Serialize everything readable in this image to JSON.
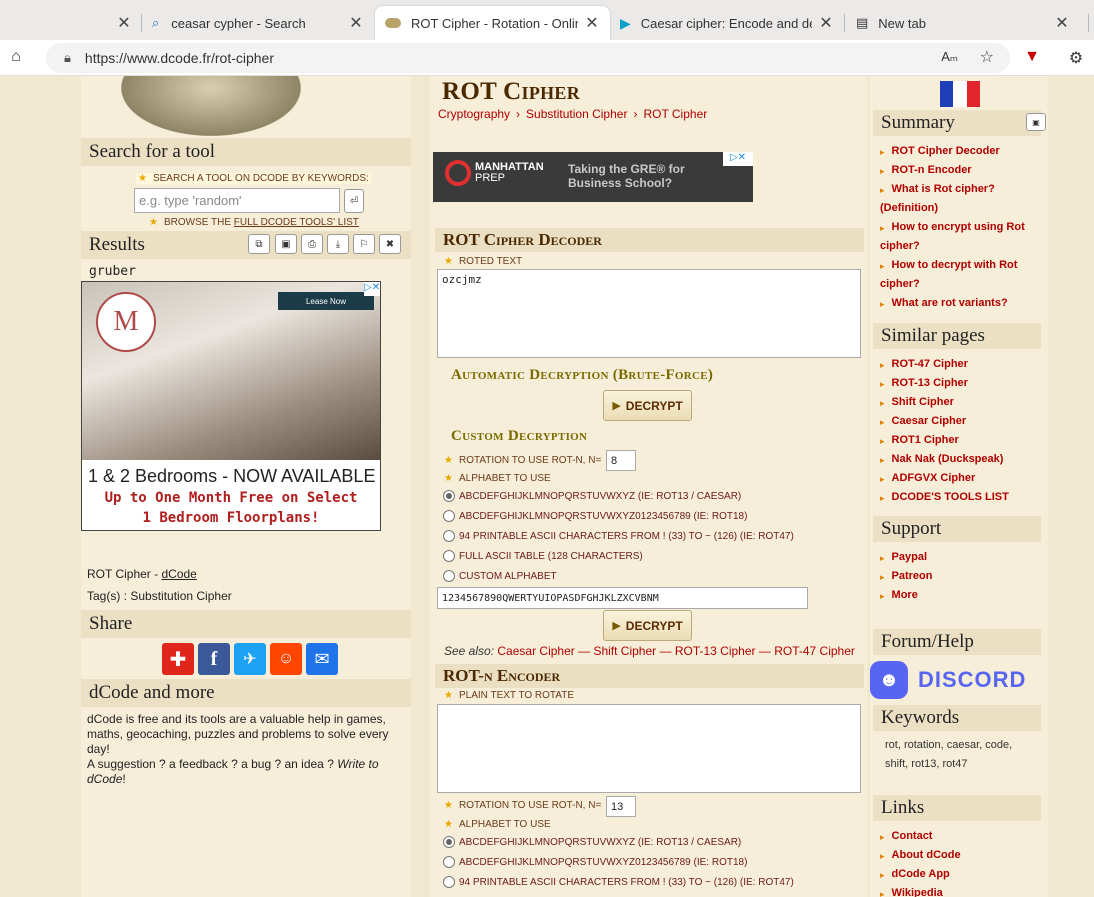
{
  "browser": {
    "tabs": [
      {
        "label": "",
        "icon": "blank"
      },
      {
        "label": "ceasar cypher - Search",
        "icon": "search-icon"
      },
      {
        "label": "ROT Cipher - Rotation - Online R",
        "icon": "dcode-icon",
        "active": true
      },
      {
        "label": "Caesar cipher: Encode and deco",
        "icon": "arrow-icon"
      },
      {
        "label": "New tab",
        "icon": "newtab-icon"
      }
    ],
    "url": "https://www.dcode.fr/rot-cipher"
  },
  "left": {
    "search_title": "Search for a tool",
    "search_keyword_label": "SEARCH A TOOL ON DCODE BY KEYWORDS:",
    "search_placeholder": "e.g. type 'random'",
    "browse_label_prefix": "BROWSE THE",
    "browse_link": "FULL DCODE TOOLS' LIST",
    "results_title": "Results",
    "result_value": "gruber",
    "ad": {
      "button": "Lease Now",
      "line1": "1 & 2 Bedrooms - NOW AVAILABLE",
      "line2": "Up to One Month Free on Select",
      "line3": "1 Bedroom Floorplans!",
      "logo": "M"
    },
    "tool_name_prefix": "ROT Cipher -",
    "tool_name_link": "dCode",
    "tags": "Tag(s) : Substitution Cipher",
    "share_title": "Share",
    "more_title": "dCode and more",
    "more_text": "dCode is free and its tools are a valuable help in games, maths, geocaching, puzzles and problems to solve every day!",
    "suggestion_text": "A suggestion ? a feedback ? a bug ? an idea ?",
    "write_to": "Write to dCode",
    "write_suffix": "!"
  },
  "main": {
    "title": "ROT Cipher",
    "breadcrumb": [
      "Cryptography",
      "Substitution Cipher",
      "ROT Cipher"
    ],
    "ad": {
      "brand": "MANHATTAN",
      "brand2": "PREP",
      "tagline1": "Taking the GRE® for",
      "tagline2": "Business School?"
    },
    "decoder": {
      "title": "ROT Cipher Decoder",
      "roted_label": "ROTED TEXT",
      "roted_value": "ozcjmz",
      "auto_title": "Automatic Decryption (Brute-Force)",
      "decrypt_btn": "DECRYPT",
      "custom_title": "Custom Decryption",
      "rot_label": "ROTATION TO USE ROT-N, N=",
      "rot_value": "8",
      "alpha_label": "ALPHABET TO USE",
      "options": [
        "ABCDEFGHIJKLMNOPQRSTUVWXYZ (IE: ROT13 / CAESAR)",
        "ABCDEFGHIJKLMNOPQRSTUVWXYZ0123456789 (IE: ROT18)",
        "94 PRINTABLE ASCII CHARACTERS FROM ! (33) TO ~ (126) (IE: ROT47)",
        "FULL ASCII TABLE (128 CHARACTERS)",
        "CUSTOM ALPHABET"
      ],
      "custom_alpha": "1234567890QWERTYUIOPASDFGHJKLZXCVBNM",
      "see_also_label": "See also:",
      "see_also": [
        "Caesar Cipher",
        "Shift Cipher",
        "ROT-13 Cipher",
        "ROT-47 Cipher"
      ]
    },
    "encoder": {
      "title": "ROT-n Encoder",
      "plain_label": "PLAIN TEXT TO ROTATE",
      "rot_label": "ROTATION TO USE ROT-N, N=",
      "rot_value": "13",
      "alpha_label": "ALPHABET TO USE",
      "options": [
        "ABCDEFGHIJKLMNOPQRSTUVWXYZ (IE: ROT13 / CAESAR)",
        "ABCDEFGHIJKLMNOPQRSTUVWXYZ0123456789 (IE: ROT18)",
        "94 PRINTABLE ASCII CHARACTERS FROM ! (33) TO ~ (126) (IE: ROT47)"
      ]
    }
  },
  "right": {
    "summary_title": "Summary",
    "summary": [
      "ROT Cipher Decoder",
      "ROT-n Encoder",
      "What is Rot cipher?",
      "(Definition)",
      "How to encrypt using Rot",
      "cipher?",
      "How to decrypt with Rot",
      "cipher?",
      "What are rot variants?"
    ],
    "similar_title": "Similar pages",
    "similar": [
      "ROT-47 Cipher",
      "ROT-13 Cipher",
      "Shift Cipher",
      "Caesar Cipher",
      "ROT1 Cipher",
      "Nak Nak (Duckspeak)",
      "ADFGVX Cipher",
      "DCODE'S TOOLS LIST"
    ],
    "support_title": "Support",
    "support": [
      "Paypal",
      "Patreon",
      "More"
    ],
    "forum_title": "Forum/Help",
    "discord": "DISCORD",
    "keywords_title": "Keywords",
    "keywords_line1": "rot, rotation, caesar, code,",
    "keywords_line2": "shift, rot13, rot47",
    "links_title": "Links",
    "links": [
      "Contact",
      "About dCode",
      "dCode App",
      "Wikipedia"
    ]
  },
  "colors": {
    "accent": "#b00000",
    "bg": "#f1e8d0",
    "header": "#ece0c4"
  }
}
